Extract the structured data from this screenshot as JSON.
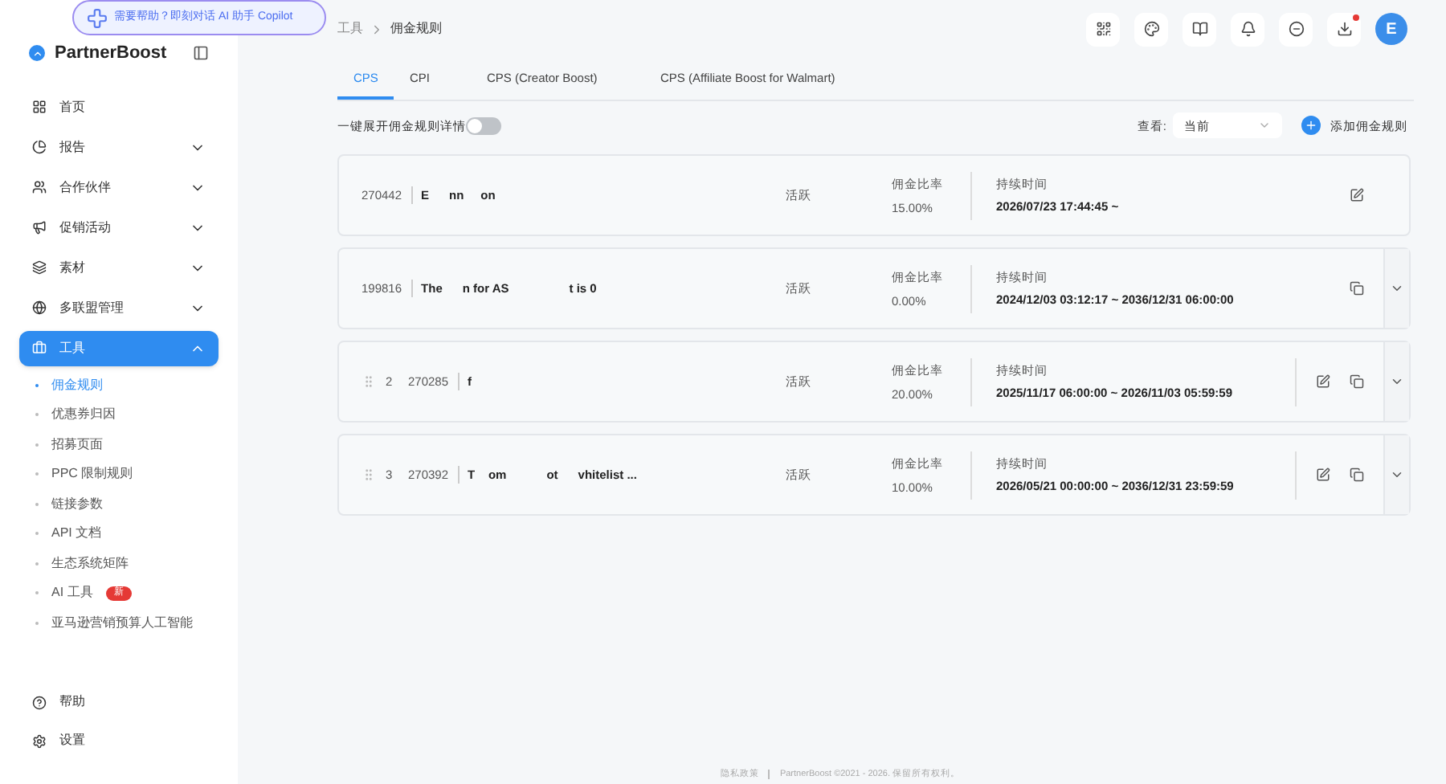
{
  "copilot": {
    "text": "需要帮助？即刻对话 AI 助手 Copilot"
  },
  "brand": {
    "name": "PartnerBoost"
  },
  "sidebar": {
    "items": [
      {
        "label": "首页",
        "expandable": false,
        "selected": false
      },
      {
        "label": "报告",
        "expandable": true,
        "expanded": false,
        "selected": false
      },
      {
        "label": "合作伙伴",
        "expandable": true,
        "expanded": false,
        "selected": false
      },
      {
        "label": "促销活动",
        "expandable": true,
        "expanded": false,
        "selected": false
      },
      {
        "label": "素材",
        "expandable": true,
        "expanded": false,
        "selected": false
      },
      {
        "label": "多联盟管理",
        "expandable": true,
        "expanded": false,
        "selected": false
      },
      {
        "label": "工具",
        "expandable": true,
        "expanded": true,
        "selected": true,
        "children": [
          {
            "label": "佣金规则",
            "selected": true
          },
          {
            "label": "优惠券归因",
            "selected": false
          },
          {
            "label": "招募页面",
            "selected": false
          },
          {
            "label": "PPC 限制规则",
            "selected": false
          },
          {
            "label": "链接参数",
            "selected": false
          },
          {
            "label": "API 文档",
            "selected": false
          },
          {
            "label": "生态系统矩阵",
            "selected": false
          },
          {
            "label": "AI 工具",
            "selected": false,
            "badge": "新"
          },
          {
            "label": "亚马逊营销预算人工智能",
            "selected": false
          }
        ]
      }
    ],
    "bottom": [
      {
        "label": "帮助"
      },
      {
        "label": "设置"
      }
    ]
  },
  "breadcrumb": [
    "工具",
    "佣金规则"
  ],
  "header_icons": [
    {
      "dot": false
    },
    {
      "dot": false
    },
    {
      "dot": false
    },
    {
      "dot": false
    },
    {
      "dot": false
    },
    {
      "dot": true
    }
  ],
  "avatar": {
    "initial": "E"
  },
  "tabs": [
    {
      "label": "CPS",
      "selected": true
    },
    {
      "label": "CPI",
      "selected": false
    },
    {
      "label": "CPS (Creator Boost)",
      "selected": false
    },
    {
      "label": "CPS (Affiliate Boost for Walmart)",
      "selected": false
    }
  ],
  "toggle": {
    "label": "一键展开佣金规则详情",
    "on": false
  },
  "view": {
    "label": "查看:",
    "value": "当前"
  },
  "add_button": {
    "label": "添加佣金规则"
  },
  "rules": [
    {
      "draggable": false,
      "id": "270442",
      "name": "E      nn     on",
      "status": "活跃",
      "rate_label": "佣金比率",
      "rate": "15.00%",
      "duration_label": "持续时间",
      "duration": "2026/07/23 17:44:45 ~",
      "editable": true,
      "copyable": false,
      "expandable": false
    },
    {
      "draggable": false,
      "id": "199816",
      "name": "The      n for AS                  t is 0",
      "status": "活跃",
      "rate_label": "佣金比率",
      "rate": "0.00%",
      "duration_label": "持续时间",
      "duration": "2024/12/03 03:12:17 ~ 2036/12/31 06:00:00",
      "editable": false,
      "copyable": true,
      "expandable": true
    },
    {
      "draggable": true,
      "index": "2",
      "id": "270285",
      "name": "f",
      "status": "活跃",
      "rate_label": "佣金比率",
      "rate": "20.00%",
      "duration_label": "持续时间",
      "duration": "2025/11/17 06:00:00 ~ 2026/11/03 05:59:59",
      "editable": true,
      "copyable": true,
      "expandable": true
    },
    {
      "draggable": true,
      "index": "3",
      "id": "270392",
      "name": "T    om            ot      vhitelist ...",
      "status": "活跃",
      "rate_label": "佣金比率",
      "rate": "10.00%",
      "duration_label": "持续时间",
      "duration": "2026/05/21 00:00:00 ~ 2036/12/31 23:59:59",
      "editable": true,
      "copyable": true,
      "expandable": true
    }
  ],
  "footer": {
    "privacy": "隐私政策",
    "copyright": "PartnerBoost ©2021 - 2026. 保留所有权利。"
  }
}
